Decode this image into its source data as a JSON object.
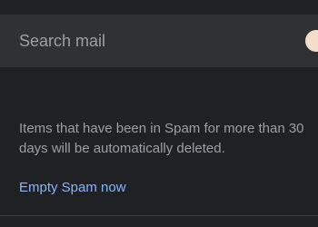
{
  "search": {
    "placeholder": "Search mail"
  },
  "spam_notice": {
    "line1": "Items that have been in Spam for more than 30",
    "line2": "days will be automatically deleted."
  },
  "actions": {
    "empty_spam_label": "Empty Spam now"
  },
  "colors": {
    "background": "#202124",
    "search_bar": "#303134",
    "notice_text": "#9aa0a6",
    "link": "#8ab4f8",
    "avatar": "#f3dfc9"
  }
}
